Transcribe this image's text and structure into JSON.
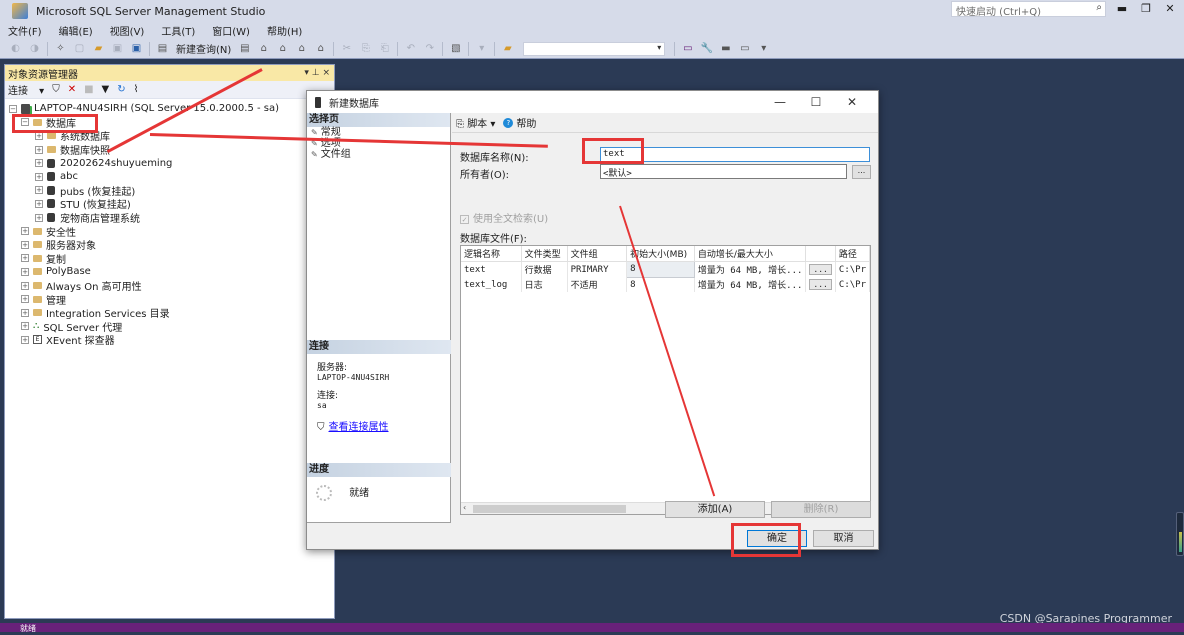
{
  "app": {
    "title": "Microsoft SQL Server Management Studio",
    "quick_launch_placeholder": "快速启动 (Ctrl+Q)",
    "window_controls": [
      "minimize",
      "restore",
      "close"
    ]
  },
  "menu": [
    "文件(F)",
    "编辑(E)",
    "视图(V)",
    "工具(T)",
    "窗口(W)",
    "帮助(H)"
  ],
  "toolbar": {
    "new_query_label": "新建查询(N)",
    "combo_value": ""
  },
  "object_explorer": {
    "title": "对象资源管理器",
    "header_controls": "▾ ⊥ ×",
    "connect_label": "连接",
    "server": "LAPTOP-4NU4SIRH (SQL Server 15.0.2000.5 - sa)",
    "databases_label": "数据库",
    "database_children": [
      {
        "label": "系统数据库",
        "type": "folder"
      },
      {
        "label": "数据库快照",
        "type": "folder"
      },
      {
        "label": "20202624shuyueming",
        "type": "db"
      },
      {
        "label": "abc",
        "type": "db"
      },
      {
        "label": "pubs (恢复挂起)",
        "type": "db"
      },
      {
        "label": "STU (恢复挂起)",
        "type": "db"
      },
      {
        "label": "宠物商店管理系统",
        "type": "db"
      }
    ],
    "server_children": [
      {
        "label": "安全性",
        "type": "folder"
      },
      {
        "label": "服务器对象",
        "type": "folder"
      },
      {
        "label": "复制",
        "type": "folder"
      },
      {
        "label": "PolyBase",
        "type": "folder"
      },
      {
        "label": "Always On 高可用性",
        "type": "folder"
      },
      {
        "label": "管理",
        "type": "folder"
      },
      {
        "label": "Integration Services 目录",
        "type": "folder"
      },
      {
        "label": "SQL Server 代理",
        "type": "agent"
      },
      {
        "label": "XEvent 探查器",
        "type": "xevent"
      }
    ]
  },
  "dialog": {
    "title": "新建数据库",
    "select_page_label": "选择页",
    "pages": [
      "常规",
      "选项",
      "文件组"
    ],
    "script_label": "脚本",
    "help_label": "帮助",
    "db_name_label": "数据库名称(N):",
    "db_name_value": "text",
    "owner_label": "所有者(O):",
    "owner_value": "<默认>",
    "browse_label": "...",
    "fulltext_label": "使用全文检索(U)",
    "fulltext_checked": true,
    "files_label": "数据库文件(F):",
    "columns": [
      "逻辑名称",
      "文件类型",
      "文件组",
      "初始大小(MB)",
      "自动增长/最大大小",
      "",
      "路径"
    ],
    "rows": [
      {
        "name": "text",
        "type": "行数据",
        "group": "PRIMARY",
        "size": "8",
        "growth": "增量为 64 MB, 增长...",
        "path": "C:\\Pr"
      },
      {
        "name": "text_log",
        "type": "日志",
        "group": "不适用",
        "size": "8",
        "growth": "增量为 64 MB, 增长...",
        "path": "C:\\Pr"
      }
    ],
    "connection_section": "连接",
    "server_label": "服务器:",
    "server_value": "LAPTOP-4NU4SIRH",
    "connection_label": "连接:",
    "connection_value": "sa",
    "view_conn_props": "查看连接属性",
    "progress_section": "进度",
    "progress_status": "就绪",
    "add_button": "添加(A)",
    "remove_button": "删除(R)",
    "ok_button": "确定",
    "cancel_button": "取消"
  },
  "statusbar": {
    "text": "就绪"
  },
  "watermark": "CSDN @Sarapines Programmer",
  "annotation_color": "#e53636"
}
